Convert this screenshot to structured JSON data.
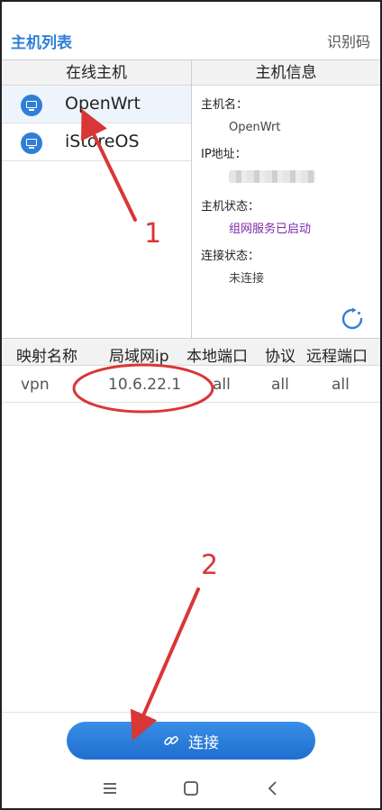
{
  "header": {
    "title": "主机列表",
    "action": "识别码"
  },
  "online_hosts": {
    "title": "在线主机",
    "items": [
      {
        "name": "OpenWrt",
        "icon": "computer-icon",
        "selected": true
      },
      {
        "name": "iStoreOS",
        "icon": "computer-icon",
        "selected": false
      }
    ]
  },
  "host_info": {
    "title": "主机信息",
    "hostname_label": "主机名：",
    "hostname_value": "OpenWrt",
    "ip_label": "IP地址：",
    "host_status_label": "主机状态：",
    "host_status_value": "组网服务已启动",
    "connection_status_label": "连接状态：",
    "connection_status_value": "未连接"
  },
  "mapping_table": {
    "columns": [
      "映射名称",
      "局域网ip",
      "本地端口",
      "协议",
      "远程端口"
    ],
    "rows": [
      [
        "vpn",
        "10.6.22.1",
        "all",
        "all",
        "all"
      ]
    ]
  },
  "connect_button": {
    "label": "连接",
    "icon": "link-icon"
  },
  "nav_bar": {
    "icons": [
      "menu-icon",
      "home-icon",
      "back-icon"
    ]
  },
  "annotations": {
    "label_1": "1",
    "label_2": "2"
  },
  "colors": {
    "accent": "#2f7fd6",
    "status": "#7b2aa6",
    "annotation": "#d93636"
  }
}
